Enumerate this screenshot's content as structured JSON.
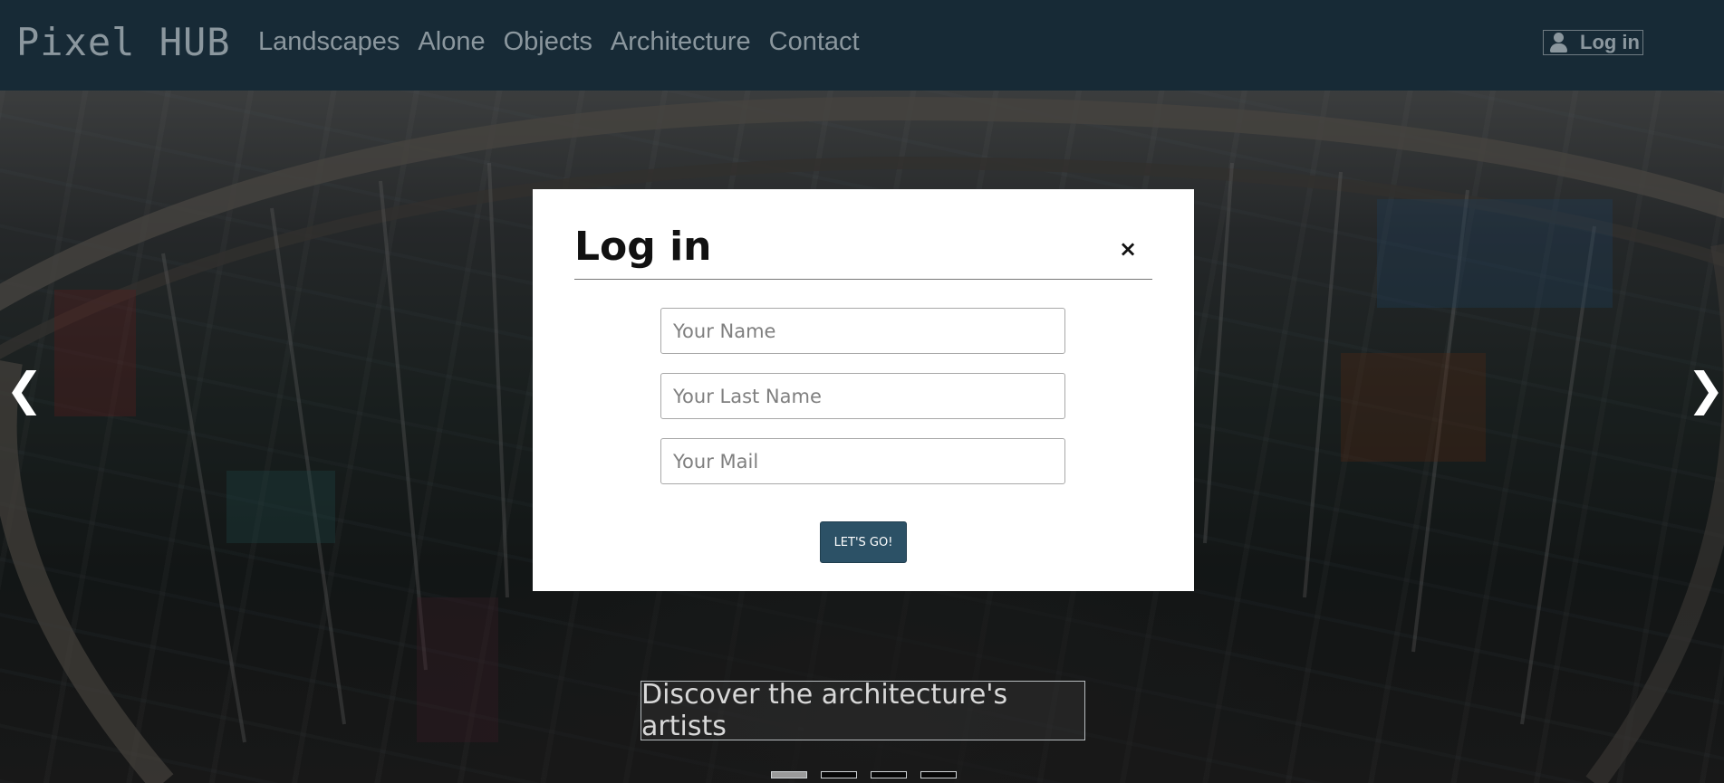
{
  "navbar": {
    "brand": "Pixel HUB",
    "links": [
      "Landscapes",
      "Alone",
      "Objects",
      "Architecture",
      "Contact"
    ],
    "login_label": "Log in",
    "login_icon": "user-icon"
  },
  "hero": {
    "caption": "Discover the architecture's artists",
    "prev_arrow": "❮",
    "next_arrow": "❯",
    "slides_count": 4,
    "active_slide": 1
  },
  "modal": {
    "title": "Log in",
    "close_symbol": "×",
    "fields": {
      "name_placeholder": "Your Name",
      "last_name_placeholder": "Your Last Name",
      "mail_placeholder": "Your Mail"
    },
    "submit_label": "LET'S GO!"
  }
}
